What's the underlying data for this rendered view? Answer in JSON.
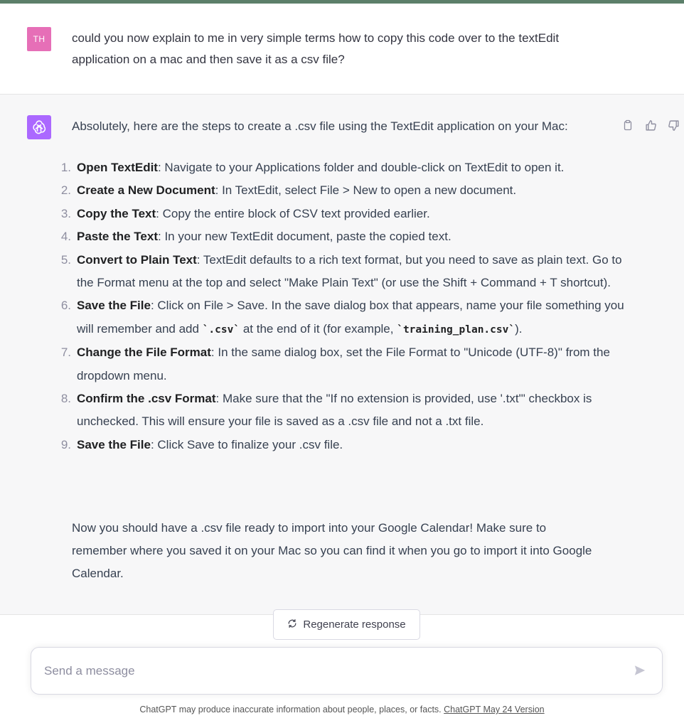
{
  "user_message": {
    "avatar_initials": "TH",
    "avatar_color": "#e66fb7",
    "text": "could you now explain to me in very simple terms how to copy this code over to the textEdit application on a mac and then save it as a csv file?"
  },
  "assistant_message": {
    "avatar_icon": "openai-logo-icon",
    "avatar_color": "#ab68ff",
    "intro": "Absolutely, here are the steps to create a .csv file using the TextEdit application on your Mac:",
    "steps": [
      {
        "num": "1.",
        "title": "Open TextEdit",
        "text": ": Navigate to your Applications folder and double-click on TextEdit to open it."
      },
      {
        "num": "2.",
        "title": "Create a New Document",
        "text": ": In TextEdit, select File > New to open a new document."
      },
      {
        "num": "3.",
        "title": "Copy the Text",
        "text": ": Copy the entire block of CSV text provided earlier."
      },
      {
        "num": "4.",
        "title": "Paste the Text",
        "text": ": In your new TextEdit document, paste the copied text."
      },
      {
        "num": "5.",
        "title": "Convert to Plain Text",
        "text": ": TextEdit defaults to a rich text format, but you need to save as plain text. Go to the Format menu at the top and select \"Make Plain Text\" (or use the Shift + Command + T shortcut)."
      },
      {
        "num": "6.",
        "title": "Save the File",
        "text_a": ": Click on File > Save. In the save dialog box that appears, name your file something you will remember and add ",
        "code_a": "`.csv`",
        "text_b": " at the end of it (for example, ",
        "code_b": "`training_plan.csv`",
        "text_c": ")."
      },
      {
        "num": "7.",
        "title": "Change the File Format",
        "text": ": In the same dialog box, set the File Format to \"Unicode (UTF-8)\" from the dropdown menu."
      },
      {
        "num": "8.",
        "title": "Confirm the .csv Format",
        "text": ": Make sure that the \"If no extension is provided, use '.txt'\" checkbox is unchecked. This will ensure your file is saved as a .csv file and not a .txt file."
      },
      {
        "num": "9.",
        "title": "Save the File",
        "text": ": Click Save to finalize your .csv file."
      }
    ],
    "outro": "Now you should have a .csv file ready to import into your Google Calendar! Make sure to remember where you saved it on your Mac so you can find it when you go to import it into Google Calendar.",
    "actions": [
      "copy-icon",
      "thumbs-up-icon",
      "thumbs-down-icon"
    ]
  },
  "regenerate": {
    "icon": "refresh-icon",
    "label": "Regenerate response"
  },
  "composer": {
    "placeholder": "Send a message",
    "send_icon": "send-icon"
  },
  "footer": {
    "text": "ChatGPT may produce inaccurate information about people, places, or facts. ",
    "link": "ChatGPT May 24 Version"
  }
}
